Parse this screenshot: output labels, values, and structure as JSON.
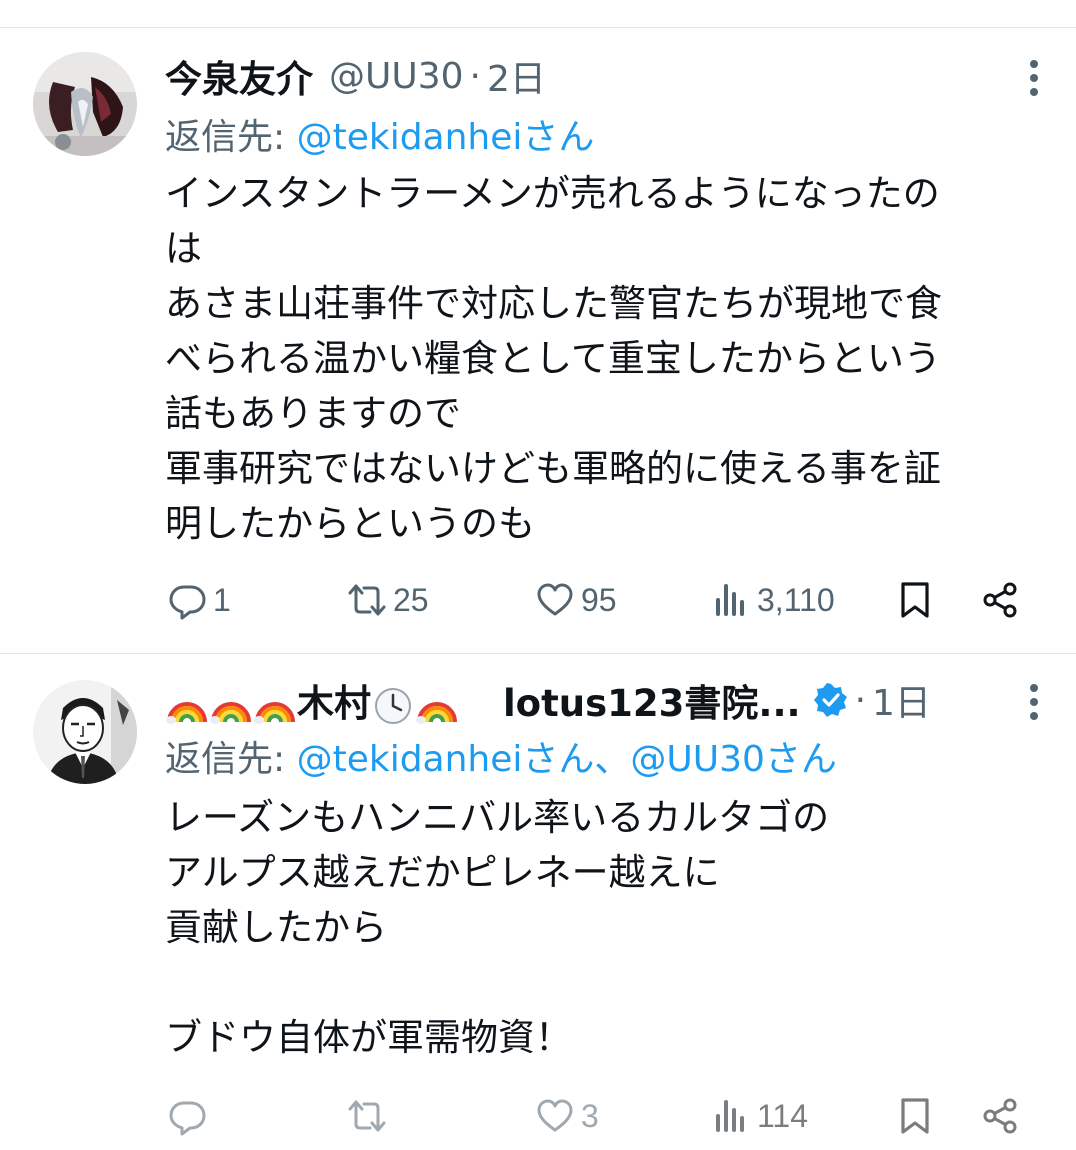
{
  "tweets": [
    {
      "display_name": "今泉友介",
      "handle": "@UU30",
      "separator": "·",
      "time": "2日",
      "reply_prefix": "返信先: ",
      "reply_mentions": "@tekidanheiさん",
      "text": "インスタントラーメンが売れるようになったの\nは\nあさま山荘事件で対応した警官たちが現地で食\nべられる温かい糧食として重宝したからという\n話もありますので\n軍事研究ではないけども軍略的に使える事を証\n明したからというのも",
      "replies": "1",
      "retweets": "25",
      "likes": "95",
      "views": "3,110"
    },
    {
      "display_name_main": "木村",
      "display_name_rest": "lotus123書院...",
      "separator": "·",
      "time": "1日",
      "reply_prefix": "返信先: ",
      "reply_mentions": "@tekidanheiさん、@UU30さん",
      "text": "レーズンもハンニバル率いるカルタゴの\nアルプス越えだかピレネー越えに\n貢献したから\n\nブドウ自体が軍需物資！",
      "replies": "",
      "retweets": "",
      "likes": "3",
      "views": "114"
    }
  ],
  "icons": [
    "more-icon",
    "reply-icon",
    "retweet-icon",
    "like-icon",
    "views-icon",
    "bookmark-icon",
    "share-icon",
    "verified-icon",
    "rainbow-icon",
    "clock-icon"
  ],
  "colors": {
    "text": "#0f1419",
    "secondary": "#536471",
    "link": "#1d9bf0",
    "divider": "#e3e6e8"
  }
}
